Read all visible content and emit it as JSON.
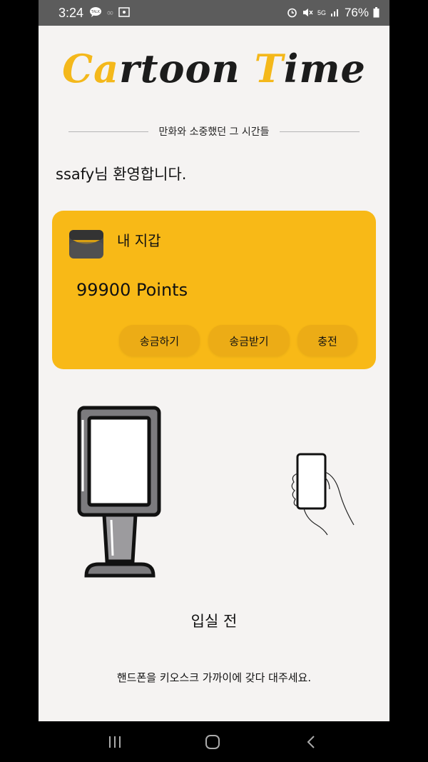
{
  "statusbar": {
    "time": "3:24",
    "battery": "76%",
    "network": "5G",
    "icons": [
      "talk-icon",
      "cast-icon",
      "alarm-icon",
      "mute-icon",
      "signal-icon",
      "battery-icon"
    ]
  },
  "app": {
    "logo_part1": "Ca",
    "logo_part2": "rtoon ",
    "logo_part3": "T",
    "logo_part4": "ime",
    "tagline": "만화와 소중했던 그 시간들",
    "welcome": "ssafy님 환영합니다."
  },
  "wallet": {
    "title": "내 지갑",
    "points": "99900 Points",
    "buttons": {
      "send": "송금하기",
      "receive": "송금받기",
      "charge": "충전"
    }
  },
  "status": {
    "label": "입실 전",
    "instruction": "핸드폰을 키오스크 가까이에 갖다 대주세요."
  },
  "colors": {
    "accent": "#f8b917",
    "button": "#ecac16",
    "background": "#f5f3f2"
  }
}
